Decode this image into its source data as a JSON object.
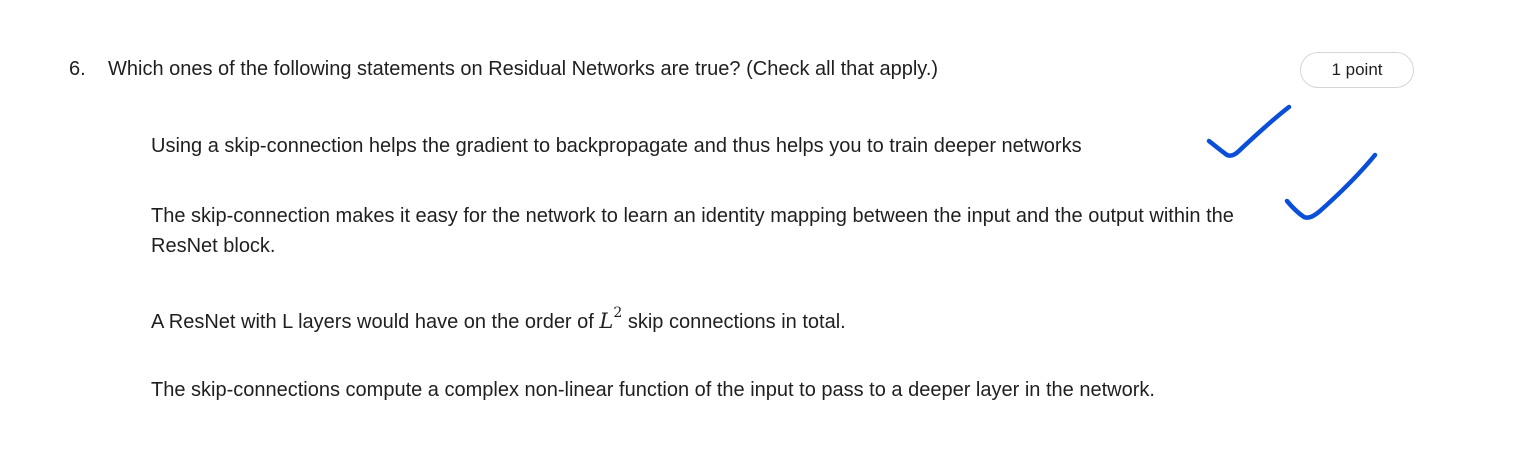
{
  "question": {
    "number": "6.",
    "text": "Which ones of the following statements on Residual Networks are true? (Check all that apply.)",
    "points": "1 point"
  },
  "options": [
    {
      "text": "Using a skip-connection helps the gradient to backpropagate and thus helps you to train deeper networks",
      "checked": true
    },
    {
      "text": "The skip-connection makes it easy for the network to learn an identity mapping between the input and the output within the ResNet block.",
      "checked": true
    },
    {
      "text_before": "A ResNet with L layers would have on the order of ",
      "math_base": "L",
      "math_exp": "2",
      "text_after": " skip connections in total.",
      "checked": false
    },
    {
      "text": "The skip-connections compute a complex non-linear function of the input to pass to a deeper layer in the network.",
      "checked": false
    }
  ],
  "annotation_color": "#0b4fd8"
}
